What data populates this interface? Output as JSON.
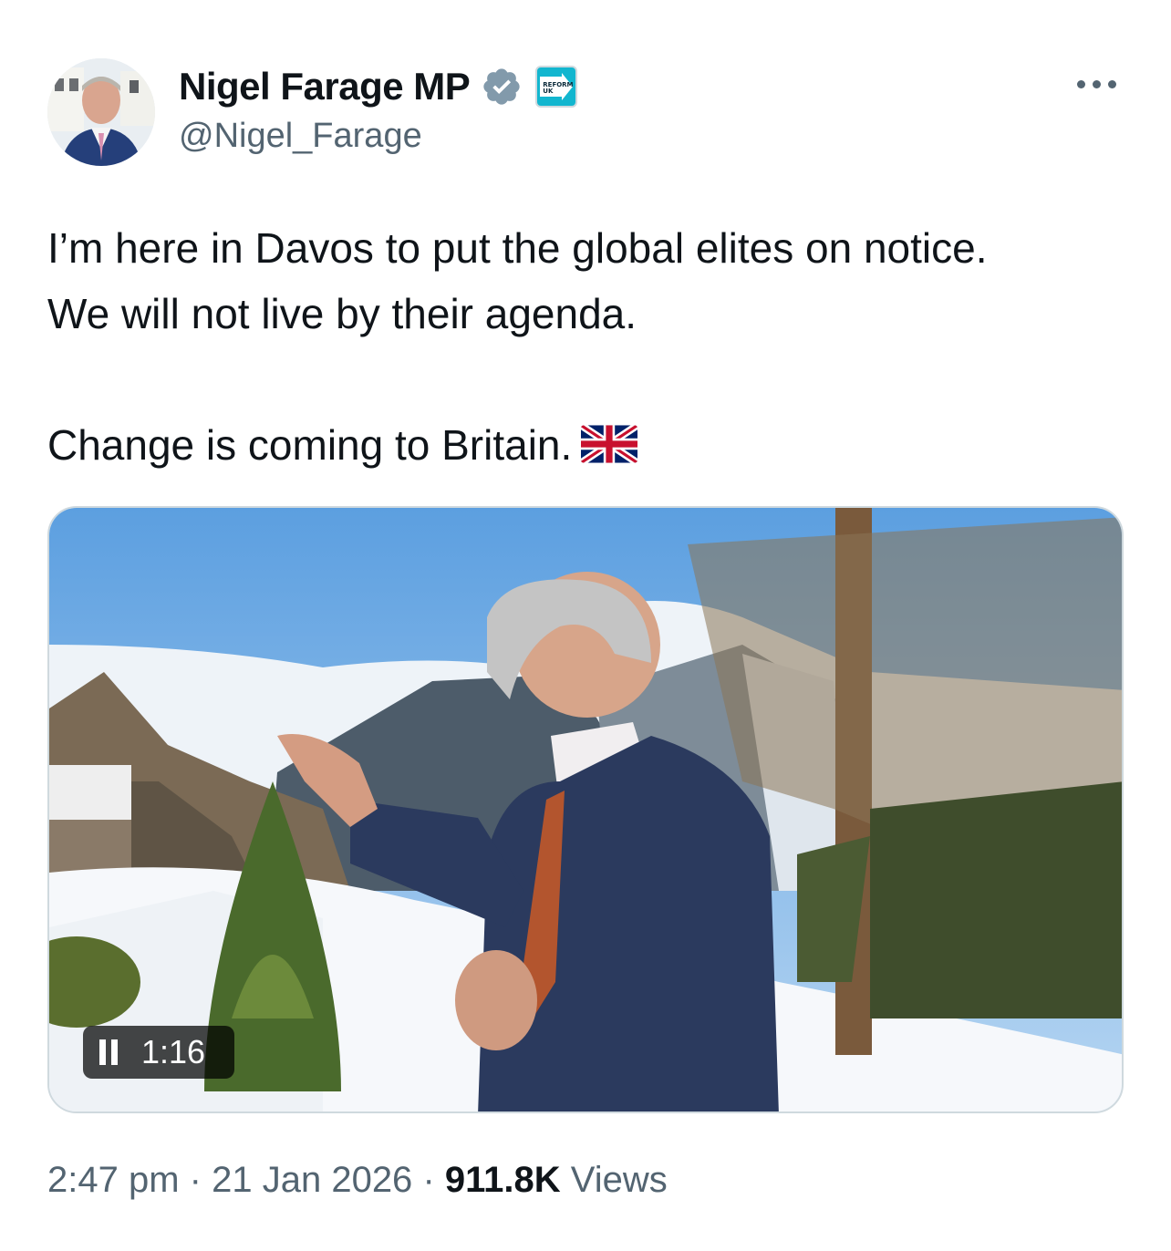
{
  "author": {
    "display_name": "Nigel Farage MP",
    "handle": "@Nigel_Farage",
    "verified": true,
    "affiliation_badge_text": [
      "REFORM",
      "UK"
    ]
  },
  "tweet": {
    "text_lines": [
      "I’m here in Davos to put the global elites on notice.",
      "We will not live by their agenda."
    ],
    "text_line_2": "Change is coming to Britain.",
    "flag_emoji": "uk-flag"
  },
  "media": {
    "type": "video",
    "state": "playing",
    "duration": "1:16"
  },
  "meta": {
    "time": "2:47 pm",
    "separator": "·",
    "date": "21 Jan 2026",
    "views_count": "911.8K",
    "views_label": "Views"
  },
  "colors": {
    "text": "#0f1419",
    "secondary": "#536471",
    "verified_badge": "#829aab",
    "border": "#cfd9de"
  }
}
